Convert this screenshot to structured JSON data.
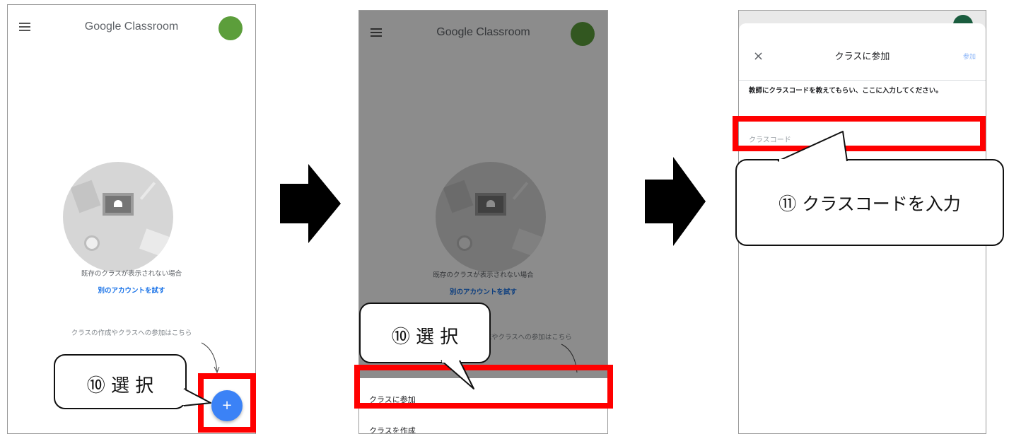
{
  "screen1": {
    "app_title": "Google Classroom",
    "empty_message": "既存のクラスが表示されない場合",
    "switch_account_link": "別のアカウントを試す",
    "hint": "クラスの作成やクラスへの参加はこちら",
    "fab_label": "+"
  },
  "screen2": {
    "app_title": "Google Classroom",
    "empty_message": "既存のクラスが表示されない場合",
    "switch_account_link": "別のアカウントを試す",
    "hint": "クラスの作成やクラスへの参加はこちら",
    "menu": [
      "クラスに参加",
      "クラスを作成"
    ]
  },
  "screen3": {
    "close_icon": "×",
    "title": "クラスに参加",
    "join_button": "参加",
    "instruction": "教師にクラスコードを教えてもらい、ここに入力してください。",
    "class_code_placeholder": "クラスコード"
  },
  "callouts": {
    "step10_a": "⑩ 選 択",
    "step10_b": "⑩ 選 択",
    "step11": "⑪ クラスコードを入力"
  },
  "colors": {
    "highlight": "#ff0000",
    "fab": "#3b82f6",
    "link": "#1a73e8",
    "avatar": "#5c9e3b"
  },
  "icons": {
    "menu": "hamburger-icon",
    "next_step": "right-arrow-icon",
    "close": "close-icon",
    "add": "plus-icon"
  }
}
